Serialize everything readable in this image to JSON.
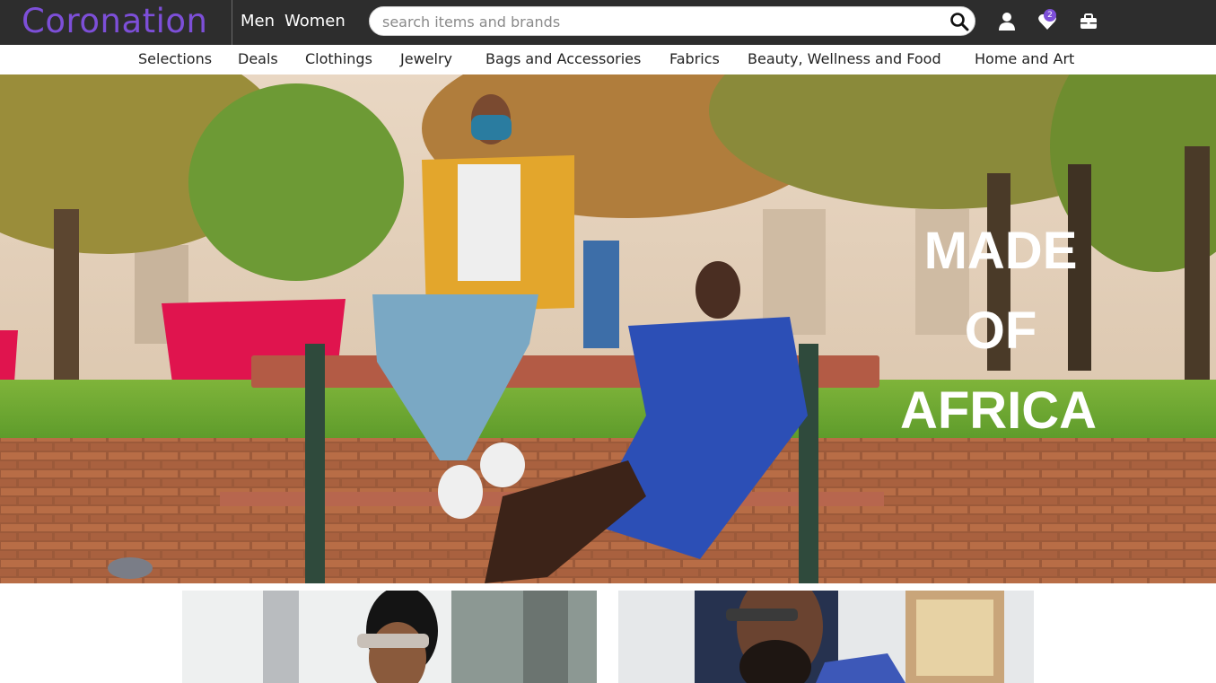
{
  "header": {
    "logo": "Coronation",
    "gender_tabs": [
      "Men",
      "Women"
    ],
    "search_placeholder": "search items and brands",
    "wishlist_count": "2",
    "icons": [
      "search-icon",
      "user-icon",
      "heart-icon",
      "briefcase-icon"
    ]
  },
  "nav": {
    "items": [
      "Selections",
      "Deals",
      "Clothings",
      "Jewelry",
      "Bags and Accessories",
      "Fabrics",
      "Beauty, Wellness and Food",
      "Home and Art"
    ]
  },
  "hero": {
    "lines": [
      "MADE",
      "OF",
      "AFRICA"
    ]
  },
  "colors": {
    "accent": "#7d4fd8",
    "topbar": "#2d2d2d"
  }
}
